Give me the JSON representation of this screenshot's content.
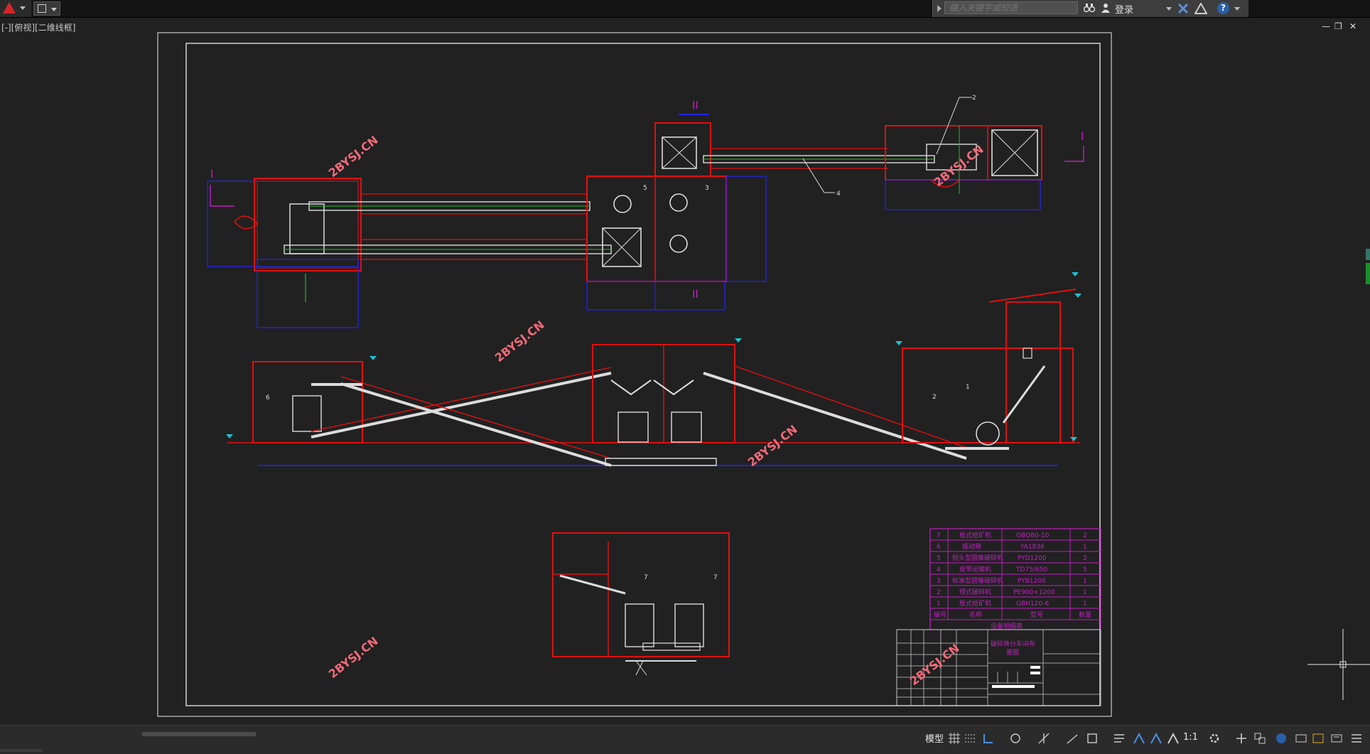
{
  "topbar": {
    "search_placeholder": "键入关键字或短语",
    "login_label": "登录",
    "help_label": "?"
  },
  "viewport": {
    "label": "[-][俯视][二维线框]",
    "min_btn": "—",
    "restore_btn": "❐",
    "close_btn": "✕"
  },
  "drawing": {
    "section_marks": {
      "I": "I",
      "II": "II"
    },
    "callouts": [
      "2",
      "3",
      "4",
      "5",
      "6",
      "7",
      "1"
    ],
    "watermark": "2BYSJ.CN",
    "parts_list": {
      "rows": [
        {
          "no": "7",
          "name": "板式给矿机",
          "model": "GBQ80-10",
          "qty": "2"
        },
        {
          "no": "6",
          "name": "振动筛",
          "model": "YA1836",
          "qty": "1"
        },
        {
          "no": "5",
          "name": "短头型圆锥破碎机",
          "model": "PYD1200",
          "qty": "2"
        },
        {
          "no": "4",
          "name": "皮带运输机",
          "model": "TD75/650",
          "qty": "5"
        },
        {
          "no": "3",
          "name": "标准型圆锥破碎机",
          "model": "PYB1200",
          "qty": "1"
        },
        {
          "no": "2",
          "name": "颚式破碎机",
          "model": "PE900×1200",
          "qty": "1"
        },
        {
          "no": "1",
          "name": "板式给矿机",
          "model": "GBH120-6",
          "qty": "1"
        }
      ],
      "header": {
        "no": "编号",
        "name": "名称",
        "model": "型号",
        "qty": "数量"
      },
      "caption": "设备明细表"
    },
    "title_block": {
      "title_line1": "破碎筛分车间布",
      "title_line2": "置图"
    }
  },
  "statusbar": {
    "model_label": "模型",
    "scale_label": "1:1"
  }
}
